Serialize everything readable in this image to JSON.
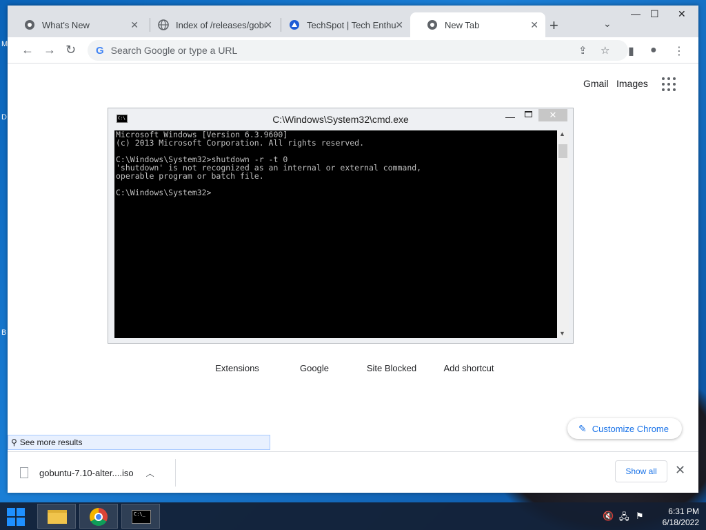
{
  "desktop": {
    "side_letters": [
      "M",
      "D",
      "B"
    ]
  },
  "browser": {
    "tabs": [
      {
        "title": "What's New",
        "icon": "chrome-icon"
      },
      {
        "title": "Index of /releases/gobu",
        "icon": "globe-icon"
      },
      {
        "title": "TechSpot | Tech Enthus",
        "icon": "techspot-icon"
      },
      {
        "title": "New Tab",
        "icon": "chrome-icon",
        "active": true
      }
    ],
    "new_tab_symbol": "+",
    "tab_search_symbol": "⌄",
    "window_controls": {
      "minimize": "—",
      "maximize": "☐",
      "close": "✕"
    },
    "omnibox": {
      "placeholder": "Search Google or type a URL",
      "g_letter": "G"
    },
    "ntp": {
      "gmail": "Gmail",
      "images": "Images",
      "shortcuts": [
        "Extensions",
        "Google",
        "Site Blocked",
        "Add shortcut"
      ],
      "customize_label": "Customize Chrome"
    },
    "suggestion": {
      "label": "See more results"
    },
    "downloads": {
      "file_name": "gobuntu-7.10-alter....iso",
      "show_all": "Show all"
    }
  },
  "cmd": {
    "title": "C:\\Windows\\System32\\cmd.exe",
    "icon_text": "C:\\",
    "console_lines": [
      "Microsoft Windows [Version 6.3.9600]",
      "(c) 2013 Microsoft Corporation. All rights reserved.",
      "",
      "C:\\Windows\\System32>shutdown -r -t 0",
      "'shutdown' is not recognized as an internal or external command,",
      "operable program or batch file.",
      "",
      "C:\\Windows\\System32>"
    ]
  },
  "taskbar": {
    "time": "6:31 PM",
    "date": "6/18/2022",
    "cmd_icon_text": "C:\\_"
  },
  "colors": {
    "accent": "#1a73e8",
    "desktop_blue": "#0a63b8",
    "console_bg": "#000000",
    "console_fg": "#c0c0c0"
  }
}
